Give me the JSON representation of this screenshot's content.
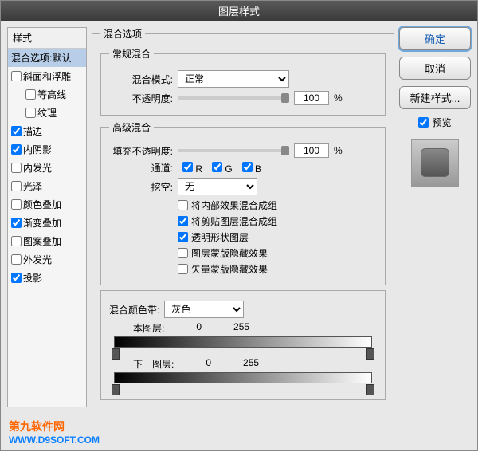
{
  "title": "图层样式",
  "sidebar": {
    "header": "样式",
    "items": [
      {
        "label": "混合选项:默认",
        "selected": true,
        "hasCheck": false
      },
      {
        "label": "斜面和浮雕",
        "checked": false,
        "hasCheck": true
      },
      {
        "label": "等高线",
        "checked": false,
        "hasCheck": true,
        "indent": true
      },
      {
        "label": "纹理",
        "checked": false,
        "hasCheck": true,
        "indent": true
      },
      {
        "label": "描边",
        "checked": true,
        "hasCheck": true
      },
      {
        "label": "内阴影",
        "checked": true,
        "hasCheck": true
      },
      {
        "label": "内发光",
        "checked": false,
        "hasCheck": true
      },
      {
        "label": "光泽",
        "checked": false,
        "hasCheck": true
      },
      {
        "label": "颜色叠加",
        "checked": false,
        "hasCheck": true
      },
      {
        "label": "渐变叠加",
        "checked": true,
        "hasCheck": true
      },
      {
        "label": "图案叠加",
        "checked": false,
        "hasCheck": true
      },
      {
        "label": "外发光",
        "checked": false,
        "hasCheck": true
      },
      {
        "label": "投影",
        "checked": true,
        "hasCheck": true
      }
    ]
  },
  "main": {
    "group_title": "混合选项",
    "normal_blend": {
      "legend": "常规混合",
      "mode_label": "混合模式:",
      "mode_value": "正常",
      "opacity_label": "不透明度:",
      "opacity_value": "100",
      "pct": "%"
    },
    "advanced_blend": {
      "legend": "高级混合",
      "fill_label": "填充不透明度:",
      "fill_value": "100",
      "pct": "%",
      "channel_label": "通道:",
      "channels": {
        "r": "R",
        "g": "G",
        "b": "B"
      },
      "knockout_label": "挖空:",
      "knockout_value": "无",
      "checks": [
        {
          "label": "将内部效果混合成组",
          "checked": false
        },
        {
          "label": "将剪贴图层混合成组",
          "checked": true
        },
        {
          "label": "透明形状图层",
          "checked": true
        },
        {
          "label": "图层蒙版隐藏效果",
          "checked": false
        },
        {
          "label": "矢量蒙版隐藏效果",
          "checked": false
        }
      ]
    },
    "blend_if": {
      "legend_label": "混合颜色带:",
      "legend_value": "灰色",
      "this_layer": "本图层:",
      "under_layer": "下一图层:",
      "low": "0",
      "high": "255"
    }
  },
  "right": {
    "ok": "确定",
    "cancel": "取消",
    "new_style": "新建样式...",
    "preview": "预览"
  },
  "footer": {
    "brand": "第九软件网",
    "url": "WWW.D9SOFT.COM"
  }
}
